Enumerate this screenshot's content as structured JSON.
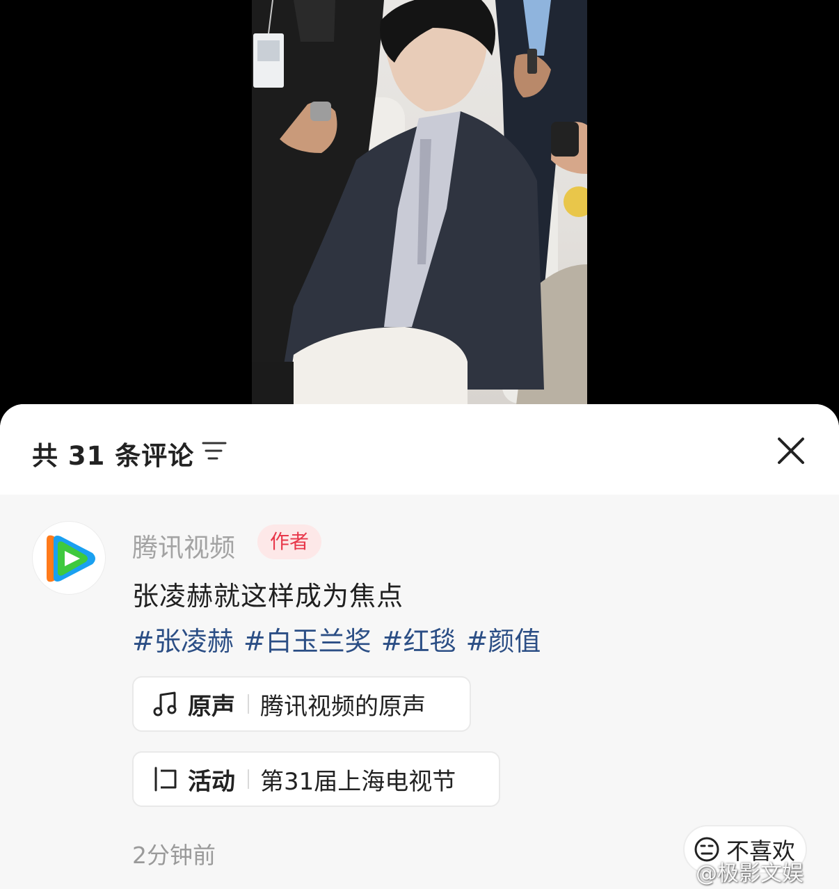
{
  "header": {
    "title": "共 31 条评论",
    "sort_icon": "sort-lines-icon",
    "close_icon": "close-icon"
  },
  "comment": {
    "avatar_icon": "tencent-video-logo",
    "author": "腾讯视频",
    "badge": "作者",
    "text": "张凌赫就这样成为焦点",
    "hashtags": [
      "#张凌赫",
      "#白玉兰奖",
      "#红毯",
      "#颜值"
    ],
    "music": {
      "icon": "music-note-icon",
      "label": "原声",
      "value": "腾讯视频的原声"
    },
    "event": {
      "icon": "event-flag-icon",
      "label": "活动",
      "value": "第31届上海电视节"
    },
    "time": "2分钟前",
    "dislike_label": "不喜欢",
    "dislike_icon": "unhappy-face-icon"
  },
  "watermark": "@极影文娱",
  "colors": {
    "hashtag": "#2b4e85",
    "badge_text": "#e8374a",
    "badge_bg": "#fde8e8",
    "author": "#a3a3a3"
  }
}
